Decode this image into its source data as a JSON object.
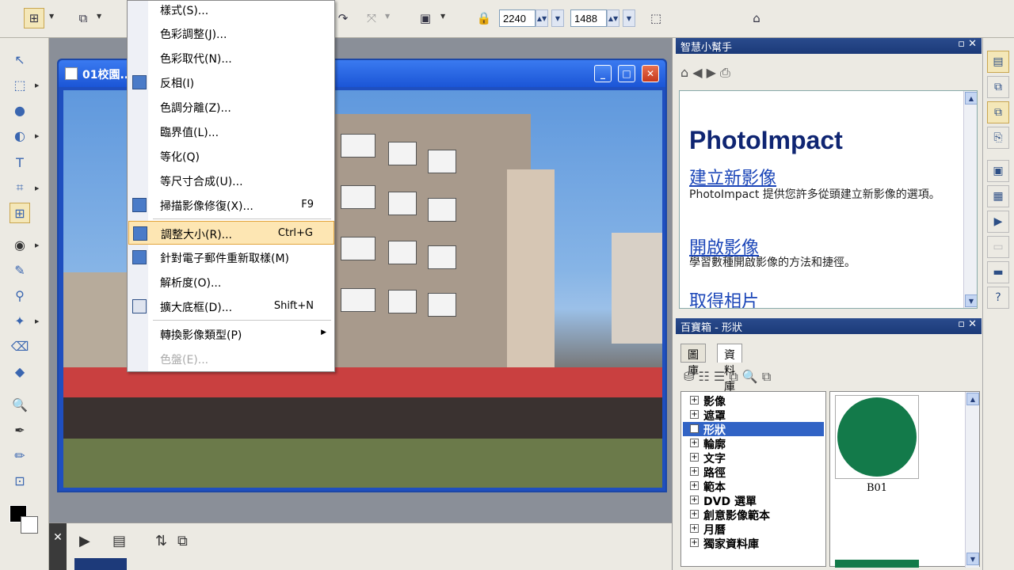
{
  "toolbar": {
    "width_value": "2240",
    "height_value": "1488"
  },
  "image_window": {
    "title": "01校園..."
  },
  "context_menu": {
    "items": [
      {
        "label": "樣式(S)...",
        "shortcut": ""
      },
      {
        "label": "色彩調整(J)...",
        "shortcut": ""
      },
      {
        "label": "色彩取代(N)...",
        "shortcut": ""
      },
      {
        "label": "反相(I)",
        "shortcut": ""
      },
      {
        "label": "色調分離(Z)...",
        "shortcut": ""
      },
      {
        "label": "臨界值(L)...",
        "shortcut": ""
      },
      {
        "label": "等化(Q)",
        "shortcut": ""
      },
      {
        "label": "等尺寸合成(U)...",
        "shortcut": ""
      },
      {
        "label": "掃描影像修復(X)...",
        "shortcut": "F9"
      },
      {
        "label": "調整大小(R)...",
        "shortcut": "Ctrl+G"
      },
      {
        "label": "針對電子郵件重新取樣(M)",
        "shortcut": ""
      },
      {
        "label": "解析度(O)...",
        "shortcut": ""
      },
      {
        "label": "擴大底框(D)...",
        "shortcut": "Shift+N"
      },
      {
        "label": "轉換影像類型(P)",
        "shortcut": ""
      },
      {
        "label": "色盤(E)...",
        "shortcut": ""
      }
    ]
  },
  "help_panel": {
    "title": "智慧小幫手",
    "logo": "PhotoImpact",
    "links": [
      {
        "label": "建立新影像",
        "desc": "PhotoImpact 提供您許多從頭建立新影像的選項。"
      },
      {
        "label": "開啟影像",
        "desc": "學習數種開啟影像的方法和捷徑。"
      },
      {
        "label": "取得相片",
        "desc": ""
      }
    ]
  },
  "toolbox_panel": {
    "title": "百寶箱 - 形狀",
    "tabs": [
      "圖庫",
      "資料庫"
    ],
    "tree": [
      "影像",
      "遮罩",
      "形狀",
      "輪廓",
      "文字",
      "路徑",
      "範本",
      "DVD 選單",
      "創意影像範本",
      "月曆",
      "獨家資料庫"
    ],
    "selected": "形狀",
    "gallery_item": "B01",
    "colors": {
      "shape": "#137a4a",
      "selection": "#3163c5"
    }
  }
}
